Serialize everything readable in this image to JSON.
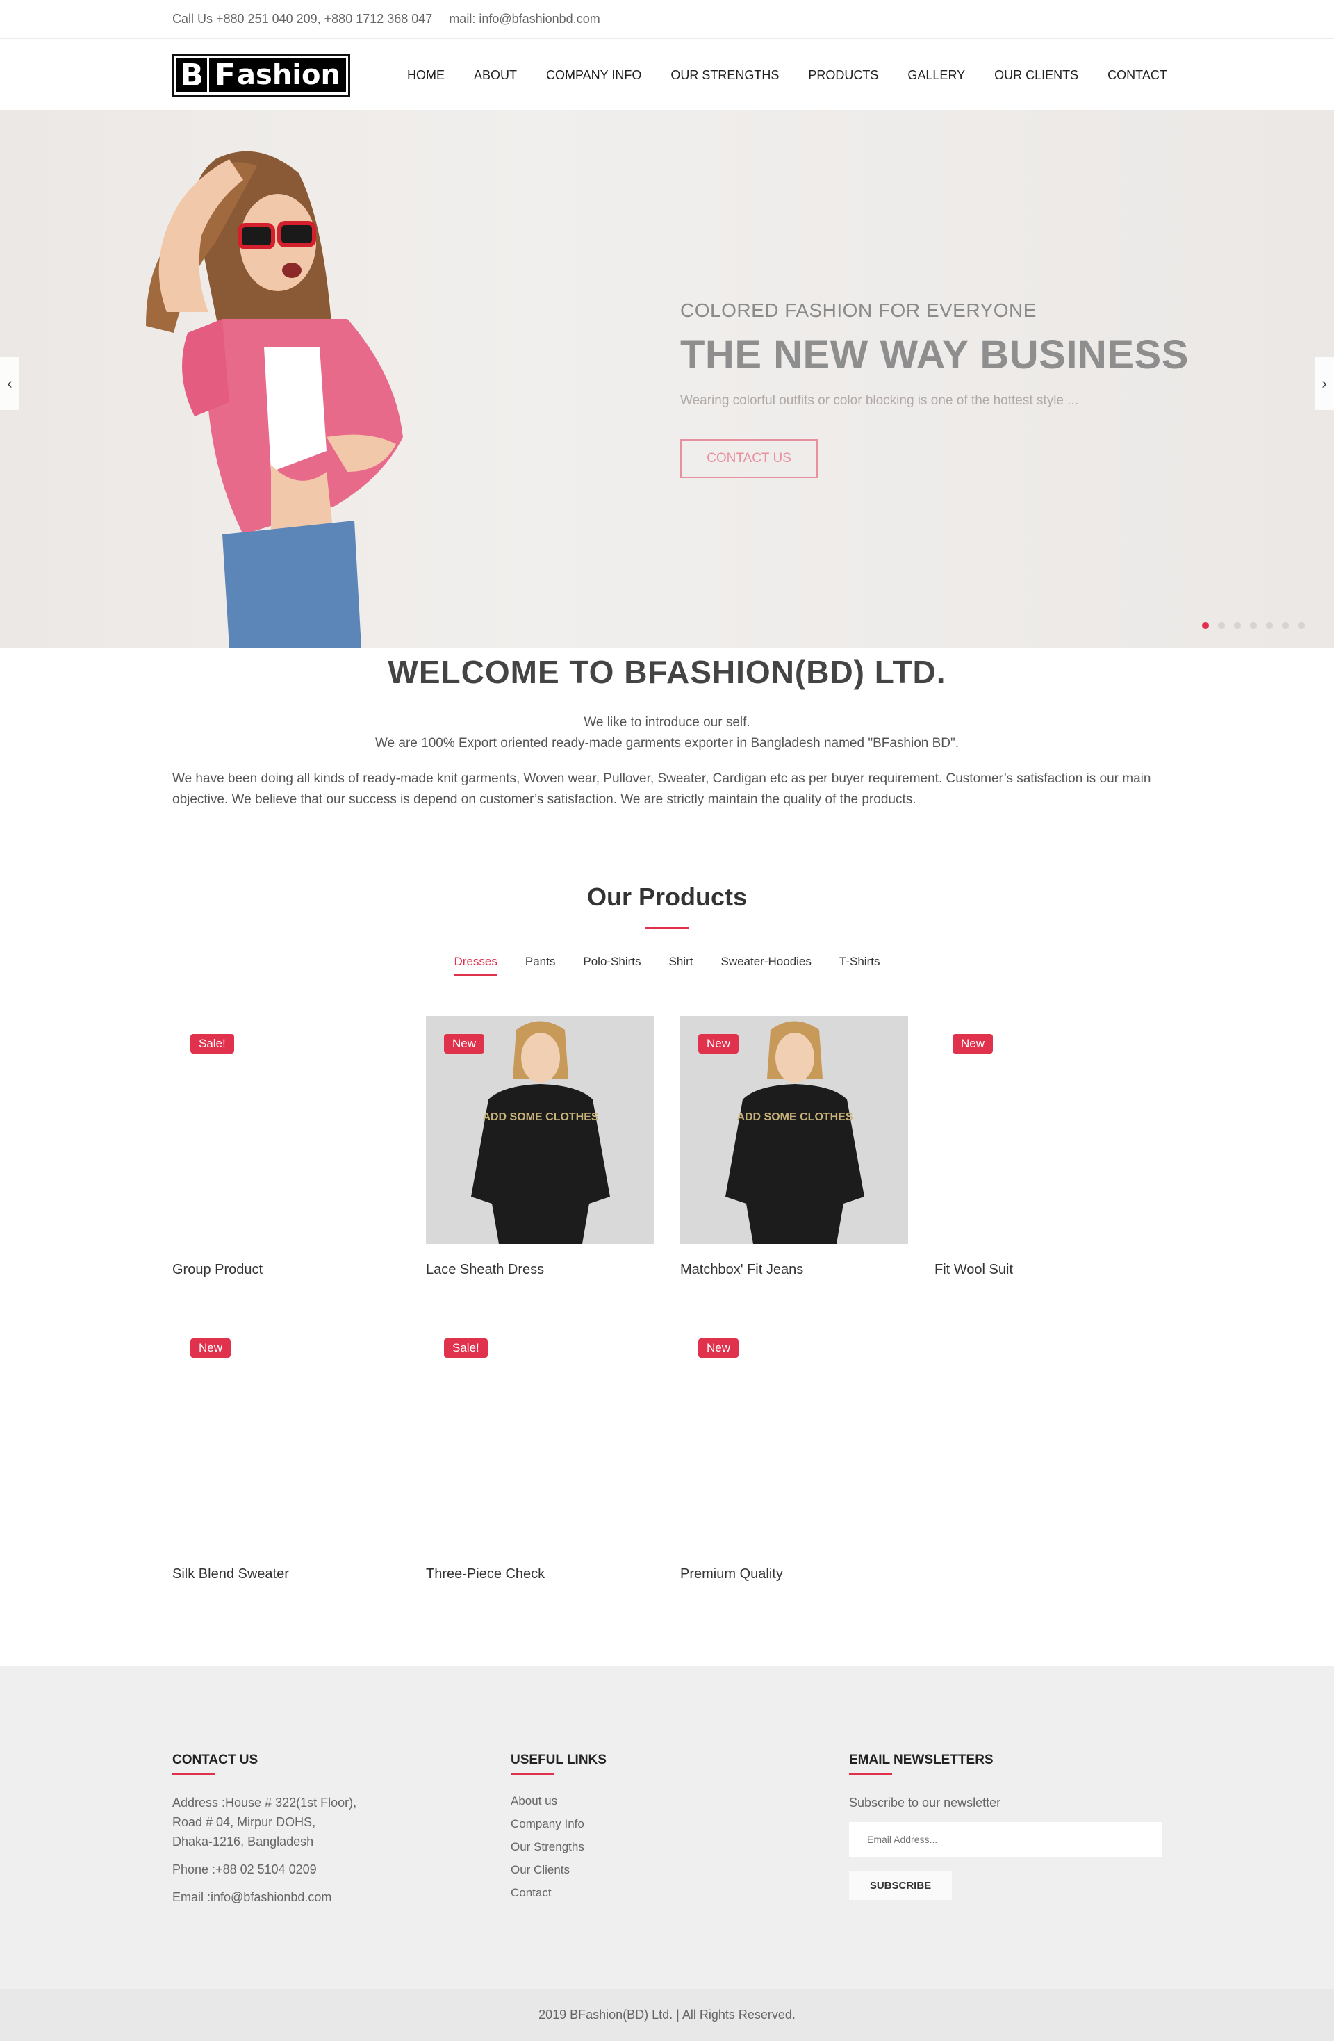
{
  "topbar": {
    "call": "Call Us +880 251 040 209, +880 1712 368 047",
    "mail": "mail: info@bfashionbd.com"
  },
  "logo": {
    "b": "B",
    "f": "F",
    "rest": "ashion"
  },
  "nav": [
    "HOME",
    "ABOUT",
    "COMPANY INFO",
    "OUR STRENGTHS",
    "PRODUCTS",
    "GALLERY",
    "OUR CLIENTS",
    "CONTACT"
  ],
  "hero": {
    "subtitle": "COLORED FASHION FOR EVERYONE",
    "title": "THE NEW WAY BUSINESS",
    "desc": "Wearing colorful outfits or color blocking is one of the hottest style ...",
    "button": "CONTACT US",
    "prev_icon": "chevron-left-icon",
    "next_icon": "chevron-right-icon",
    "slides": 7,
    "active_slide": 1,
    "accent": "#e0314d"
  },
  "welcome": {
    "title": "WELCOME TO BFASHION(BD) LTD.",
    "line1": "We like to introduce our self.",
    "line2": "We are 100% Export oriented ready-made garments exporter in Bangladesh named \"BFashion BD\".",
    "para": "We have been doing all kinds of ready-made knit garments, Woven wear, Pullover, Sweater, Cardigan etc as per buyer requirement. Customer’s satisfaction is our main objective. We believe that our success is depend on customer’s satisfaction. We are strictly maintain the quality of the products."
  },
  "products": {
    "title": "Our Products",
    "tabs": [
      "Dresses",
      "Pants",
      "Polo-Shirts",
      "Shirt",
      "Sweater-Hoodies",
      "T-Shirts"
    ],
    "active_tab": "Dresses",
    "items": [
      {
        "name": "Group Product",
        "badge": "Sale!"
      },
      {
        "name": "Lace Sheath Dress",
        "badge": "New"
      },
      {
        "name": "Matchbox' Fit Jeans",
        "badge": "New"
      },
      {
        "name": "Fit Wool Suit",
        "badge": "New"
      },
      {
        "name": "Silk Blend Sweater",
        "badge": "New"
      },
      {
        "name": "Three-Piece Check",
        "badge": "Sale!"
      },
      {
        "name": "Premium Quality",
        "badge": "New"
      }
    ],
    "shirt_text": "ADD SOME CLOTHES"
  },
  "footer": {
    "contact": {
      "heading": "CONTACT US",
      "address1": "Address :House # 322(1st Floor),",
      "address2": "Road # 04, Mirpur DOHS,",
      "address3": "Dhaka-1216, Bangladesh",
      "phone": "Phone :+88 02 5104 0209",
      "email": "Email :info@bfashionbd.com"
    },
    "links": {
      "heading": "USEFUL LINKS",
      "items": [
        "About us",
        "Company Info",
        "Our Strengths",
        "Our Clients",
        "Contact"
      ]
    },
    "newsletter": {
      "heading": "EMAIL NEWSLETTERS",
      "text": "Subscribe to our newsletter",
      "placeholder": "Email Address...",
      "button": "SUBSCRIBE"
    },
    "copyright": "2019 BFashion(BD) Ltd. | All Rights Reserved."
  }
}
